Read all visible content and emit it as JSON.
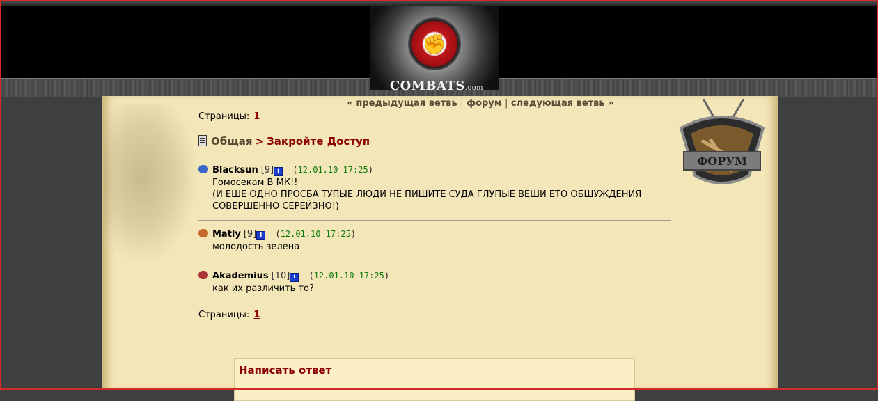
{
  "header": {
    "logo_text": "COMBATS",
    "logo_suffix": ".com"
  },
  "nav": {
    "prev_label": "« предыдущая ветвь",
    "forum_label": "форум",
    "next_label": "следующая ветвь »",
    "separator": "|"
  },
  "pages_top": {
    "label": "Страницы:",
    "page": "1"
  },
  "pages_bottom": {
    "label": "Страницы:",
    "page": "1"
  },
  "breadcrumb": {
    "section": "Общая",
    "separator": ">",
    "topic": "Закройте Доступ"
  },
  "badge": {
    "label": "ФОРУМ"
  },
  "posts": [
    {
      "nick": "Blacksun",
      "level": "[9]",
      "date_open": "(",
      "date": "12.01.10 17:25",
      "date_close": ")",
      "lines": [
        "Гомосекам В МК!!",
        "(И ЕШЕ ОДНО ПРОСБА ТУПЫЕ ЛЮДИ НЕ ПИШИТЕ СУДА ГЛУПЫЕ ВЕШИ ЕТО ОБШУЖДЕНИЯ",
        "СОВЕРШЕННО СЕРЕЙЗНО!)"
      ]
    },
    {
      "nick": "Matly",
      "level": "[9]",
      "date_open": "(",
      "date": "12.01.10 17:25",
      "date_close": ")",
      "lines": [
        "молодость зелена"
      ]
    },
    {
      "nick": "Akademius",
      "level": "[10]",
      "date_open": "(",
      "date": "12.01.10 17:25",
      "date_close": ")",
      "lines": [
        "как их различить то?"
      ]
    }
  ],
  "reply": {
    "title": "Написать ответ"
  },
  "colors": {
    "parchment": "#f3e6b8",
    "link_dark_red": "#8b0000",
    "date_green": "#0a7a0a",
    "frame_red": "#d32a2a"
  }
}
